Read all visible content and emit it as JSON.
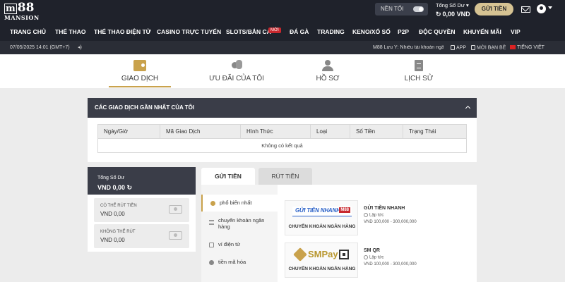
{
  "header": {
    "logo_main": "88",
    "logo_sub": "MANSION",
    "night_mode_label": "NỀN TỐI",
    "balance_label": "Tổng Số Dư",
    "balance_value": "0,00 VND",
    "deposit_button": "GỬI TIỀN"
  },
  "nav": {
    "items": [
      "TRANG CHỦ",
      "THỂ THAO",
      "THỂ THAO ĐIỆN TỬ",
      "CASINO TRỰC TUYẾN",
      "SLOTS/BẮN CÁ",
      "ĐÁ GÀ",
      "TRADING",
      "KENO/XỔ SỐ",
      "P2P",
      "ĐỘC QUYỀN",
      "KHUYẾN MÃI",
      "VIP"
    ],
    "new_badge": "MỚI"
  },
  "infobar": {
    "datetime": "07/05/2025 14:01 (GMT+7)",
    "notice": "M88 Lưu Ý: Nhiều tài khoản ngân",
    "app_label": "APP",
    "refer_label": "MỜI BẠN BÈ",
    "language_label": "TIẾNG VIỆT"
  },
  "account_tabs": [
    {
      "label": "GIAO DỊCH",
      "active": true
    },
    {
      "label": "ƯU ĐÃI CỦA TÔI",
      "active": false
    },
    {
      "label": "HỒ SƠ",
      "active": false
    },
    {
      "label": "LỊCH SỬ",
      "active": false
    }
  ],
  "transactions": {
    "title": "CÁC GIAO DỊCH GẦN NHẤT CỦA TÔI",
    "columns": [
      "Ngày/Giờ",
      "Mã Giao Dịch",
      "Hình Thức",
      "Loại",
      "Số Tiền",
      "Trạng Thái"
    ],
    "empty_text": "Không có kết quả"
  },
  "balance_card": {
    "total_label": "Tổng Số Dư",
    "total_value": "VND 0,00",
    "withdrawable_label": "CÓ THỂ RÚT TIỀN",
    "withdrawable_value": "VND 0,00",
    "locked_label": "KHÔNG THỂ RÚT",
    "locked_value": "VND 0,00"
  },
  "deposit": {
    "tabs": [
      "GỬI TIỀN",
      "RÚT TIỀN"
    ],
    "methods": [
      "phổ biến nhất",
      "chuyển khoản ngân hàng",
      "ví điện tử",
      "tiền mã hóa"
    ],
    "cards": [
      {
        "logo_text": "GỬI TIỀN NHANH",
        "logo_badge": "M88",
        "caption": "CHUYỂN KHOẢN NGÂN HÀNG",
        "name": "GỬI TIỀN NHANH",
        "speed": "Lập tức",
        "range": "VND 100,000 - 300,000,000"
      },
      {
        "logo_text": "SMPay",
        "caption": "CHUYỂN KHOẢN NGÂN HÀNG",
        "name": "SM QR",
        "speed": "Lập tức",
        "range": "VND 100,000 - 300,000,000"
      }
    ]
  }
}
